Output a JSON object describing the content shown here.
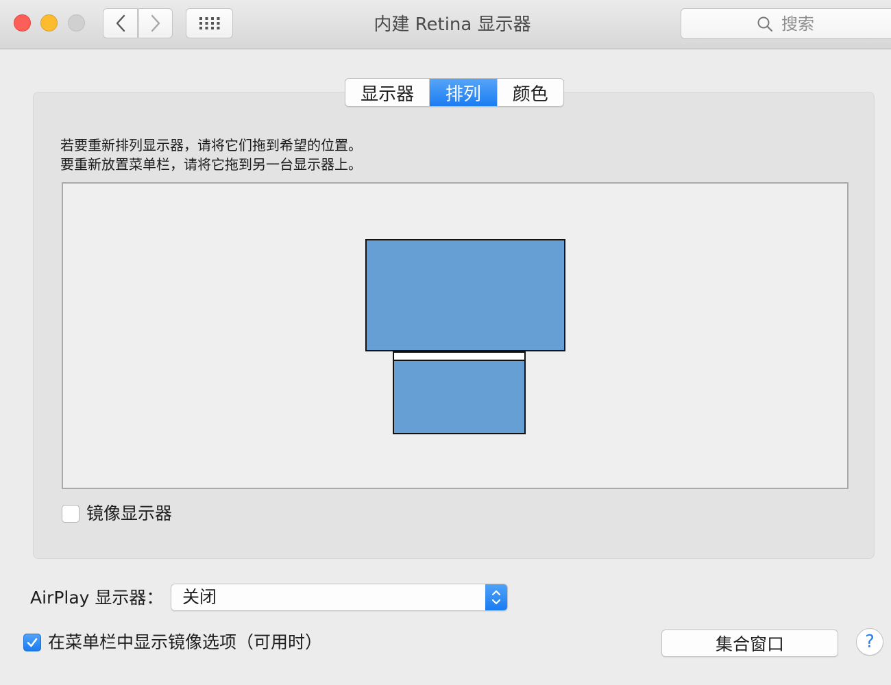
{
  "window": {
    "title": "内建 Retina 显示器",
    "search_placeholder": "搜索"
  },
  "toolbar": {
    "back_icon": "chevron-left-icon",
    "forward_icon": "chevron-right-icon",
    "grid_icon": "grid-icon"
  },
  "tabs": [
    {
      "label": "显示器",
      "selected": false
    },
    {
      "label": "排列",
      "selected": true
    },
    {
      "label": "颜色",
      "selected": false
    }
  ],
  "instructions": {
    "line1": "若要重新排列显示器，请将它们拖到希望的位置。",
    "line2": "要重新放置菜单栏，请将它拖到另一台显示器上。"
  },
  "mirror": {
    "label": "镜像显示器",
    "checked": false
  },
  "airplay": {
    "label": "AirPlay 显示器：",
    "value": "关闭"
  },
  "show_in_menubar": {
    "label": "在菜单栏中显示镜像选项（可用时）",
    "checked": true
  },
  "buttons": {
    "gather": "集合窗口",
    "help": "?"
  },
  "colors": {
    "accent": "#1b7cf2",
    "display_fill": "#669fd3",
    "close": "#fc5f57",
    "minimize": "#fdbc2e"
  }
}
